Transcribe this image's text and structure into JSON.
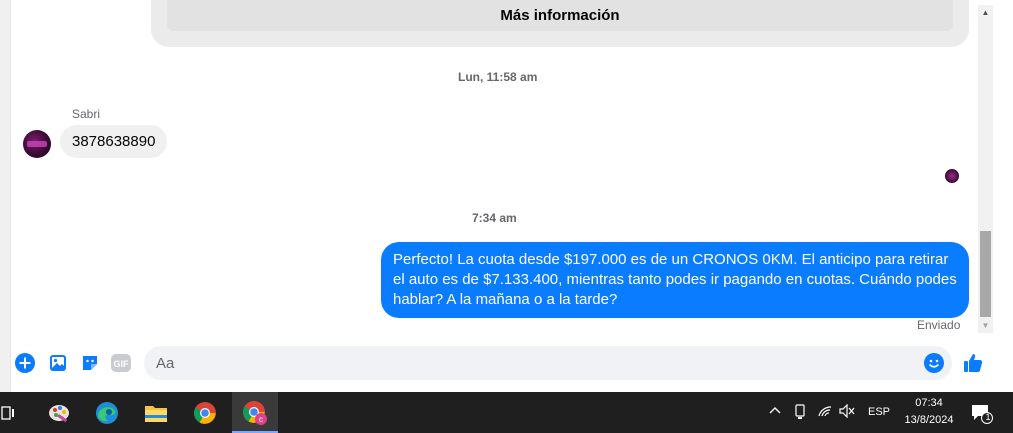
{
  "chat": {
    "more_info_label": "Más información",
    "timestamp_1": "Lun, 11:58 am",
    "sender_name": "Sabri",
    "incoming_message": "3878638890",
    "timestamp_2": "7:34 am",
    "outgoing_message": "Perfecto! La cuota desde $197.000 es de un CRONOS 0KM. El anticipo para retirar el auto es de $7.133.400, mientras tanto podes ir pagando en cuotas. Cuándo podes hablar? A la mañana o a la tarde?",
    "status": "Enviado"
  },
  "composer": {
    "placeholder": "Aa",
    "icons": [
      "plus-icon",
      "photo-icon",
      "sticker-icon",
      "gif-icon",
      "emoji-icon",
      "thumbs-up-icon"
    ],
    "gif_label": "GIF"
  },
  "taskbar": {
    "apps": [
      "task-view-icon",
      "paint-icon",
      "edge-icon",
      "file-explorer-icon",
      "chrome-icon",
      "chrome-profile-icon"
    ],
    "language": "ESP",
    "time": "07:34",
    "date": "13/8/2024",
    "notification_count": "1"
  },
  "colors": {
    "accent": "#0a7cff",
    "bubble_in": "#f0f0f0",
    "taskbar": "#1f1f1f"
  }
}
